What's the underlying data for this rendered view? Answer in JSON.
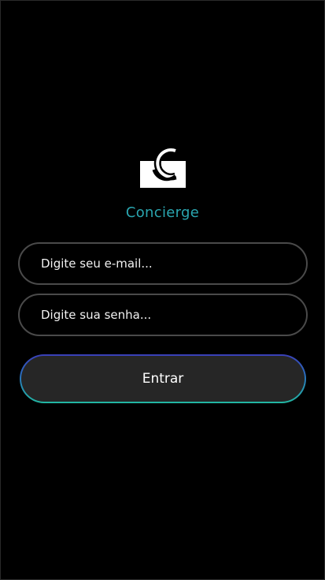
{
  "app": {
    "brand_name": "Concierge",
    "logo_icon": "concierge-logo-icon"
  },
  "login": {
    "email_placeholder": "Digite seu e-mail...",
    "email_value": "",
    "password_placeholder": "Digite sua senha...",
    "password_value": "",
    "submit_label": "Entrar"
  },
  "colors": {
    "background": "#000000",
    "brand_text": "#2aa6b0",
    "field_border": "#4a4a4a",
    "button_fill": "#262626",
    "button_gradient_top": "#3a3fb8",
    "button_gradient_bottom": "#22b7a2"
  }
}
